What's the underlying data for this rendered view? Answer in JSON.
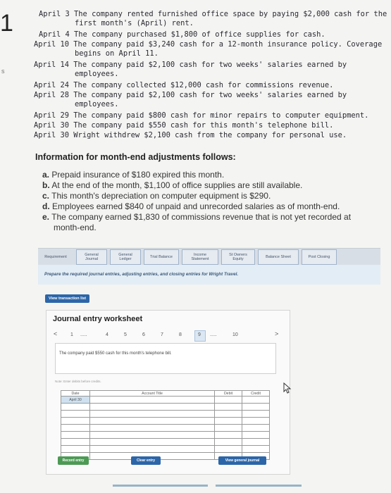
{
  "transactions": [
    "April 3 The company rented furnished office space by paying $2,000 cash for the",
    "first month's (April) rent.",
    "April 4 The company purchased $1,800 of office supplies for cash.",
    "April 10 The company paid $3,240 cash for a 12-month insurance policy. Coverage",
    "begins on April 11.",
    "April 14 The company paid $2,100 cash for two weeks' salaries earned by",
    "employees.",
    "April 24 The company collected $12,000 cash for commissions revenue.",
    "April 28 The company paid $2,100 cash for two weeks' salaries earned by",
    "employees.",
    "April 29 The company paid $800 cash for minor repairs to computer equipment.",
    "April 30 The company paid $550 cash for this month's telephone bill.",
    "April 30 Wright withdrew $2,100 cash from the company for personal use."
  ],
  "gutter_number": "1",
  "gutter_mark": "s",
  "info_heading": "Information for month-end adjustments follows:",
  "adjustments": [
    {
      "letter": "a.",
      "text": "Prepaid insurance of $180 expired this month."
    },
    {
      "letter": "b.",
      "text": "At the end of the month, $1,100 of office supplies are still available."
    },
    {
      "letter": "c.",
      "text": "This month's depreciation on computer equipment is $290."
    },
    {
      "letter": "d.",
      "text": "Employees earned $840 of unpaid and unrecorded salaries as of month-end."
    },
    {
      "letter": "e.",
      "text": "The company earned $1,830 of commissions revenue that is not yet recorded at"
    },
    {
      "letter": "",
      "text": "month-end."
    }
  ],
  "tabs": [
    {
      "label": "Requirement"
    },
    {
      "label": "General Journal",
      "l1": "General",
      "l2": "Journal"
    },
    {
      "label": "General Ledger",
      "l1": "General",
      "l2": "Ledger"
    },
    {
      "label": "Trial Balance"
    },
    {
      "label": "Income Statement",
      "l1": "Income",
      "l2": "Statement"
    },
    {
      "label": "St Owners Equity",
      "l1": "St Owners",
      "l2": "Equity"
    },
    {
      "label": "Balance Sheet"
    },
    {
      "label": "Post Closing"
    }
  ],
  "instruction": "Prepare the required journal entries, adjusting entries, and closing entries for Wright Travel.",
  "view_transaction_list": "View transaction list",
  "worksheet": {
    "title": "Journal entry worksheet",
    "prev": "<",
    "next": ">",
    "pages": [
      "1",
      ".....",
      "4",
      "5",
      "6",
      "7",
      "8",
      "9",
      ".....",
      "10"
    ],
    "description": "The company paid $550 cash for this month's telephone bill.",
    "note": "Note: Enter debits before credits.",
    "col_date": "Date",
    "col_account": "Account Title",
    "col_debit": "Debit",
    "col_credit": "Credit",
    "date_value": "April 30",
    "record_entry": "Record entry",
    "clear_entry": "Clear entry",
    "view_general_journal": "View general journal"
  },
  "colors": {
    "button_green": "#4d9a55",
    "button_blue": "#2c66a8",
    "highlight": "#dbe7f3"
  }
}
